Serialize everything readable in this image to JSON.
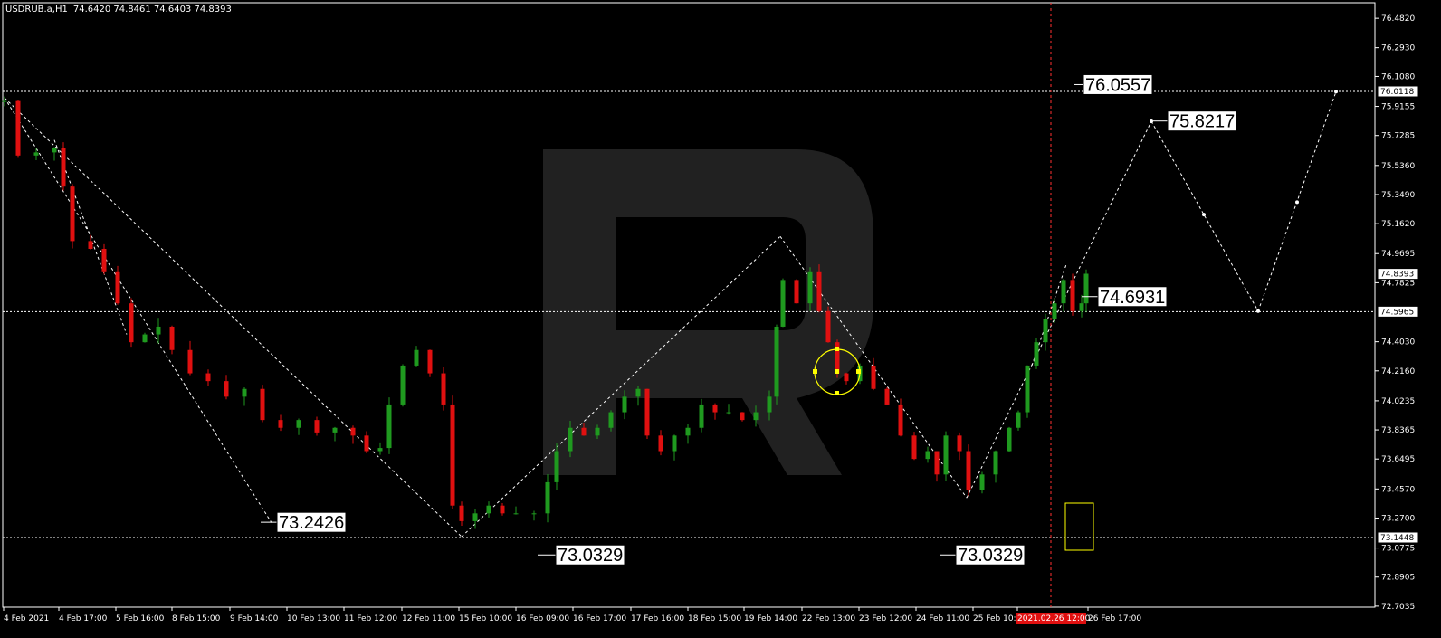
{
  "header": {
    "symbol": "USDRUB.a,H1",
    "ohlc": "74.6420 74.8461 74.6403 74.8393"
  },
  "chart_data": {
    "type": "candlestick",
    "y_axis": {
      "min": 72.705,
      "max": 76.5,
      "ticks": [
        "76.4820",
        "76.2930",
        "76.1080",
        "75.9155",
        "75.7285",
        "75.5360",
        "75.3490",
        "75.1620",
        "74.9695",
        "74.7825",
        "74.4030",
        "74.2160",
        "74.0235",
        "73.8365",
        "73.6495",
        "73.4570",
        "73.2700",
        "73.0775",
        "72.8905",
        "72.7035"
      ]
    },
    "x_axis": {
      "ticks": [
        "4 Feb 2021",
        "4 Feb 17:00",
        "5 Feb 16:00",
        "8 Feb 15:00",
        "9 Feb 14:00",
        "10 Feb 13:00",
        "11 Feb 12:00",
        "12 Feb 11:00",
        "15 Feb 10:00",
        "16 Feb 09:00",
        "16 Feb 17:00",
        "17 Feb 16:00",
        "18 Feb 15:00",
        "19 Feb 14:00",
        "22 Feb 13:00",
        "23 Feb 12:00",
        "24 Feb 11:00",
        "25 Feb 10:00",
        "2021.02.26 12:00",
        "26 Feb 17:00"
      ],
      "highlighted": "2021.02.26 12:00"
    },
    "levels": [
      {
        "price": 76.0118,
        "label": "76.0118",
        "style": "dotted-white"
      },
      {
        "price": 74.5965,
        "label": "74.5965",
        "style": "dotted-white"
      },
      {
        "price": 73.1448,
        "label": "73.1448",
        "style": "dotted-white"
      },
      {
        "price": 74.8393,
        "label": "74.8393",
        "style": "current"
      }
    ],
    "annotations": [
      {
        "text": "76.0557",
        "price": 76.0557
      },
      {
        "text": "75.8217",
        "price": 75.8217
      },
      {
        "text": "74.6931",
        "price": 74.6931
      },
      {
        "text": "73.2426",
        "price": 73.2426
      },
      {
        "text": "73.0329",
        "price": 73.0329
      },
      {
        "text": "73.0329",
        "price": 73.0329
      }
    ],
    "colors": {
      "bull": "#1f9a1f",
      "bear": "#e01010",
      "background": "#000000",
      "grid_line": "#ffffff",
      "cursor_line": "#ff3030",
      "circle": "#ffff00"
    }
  }
}
